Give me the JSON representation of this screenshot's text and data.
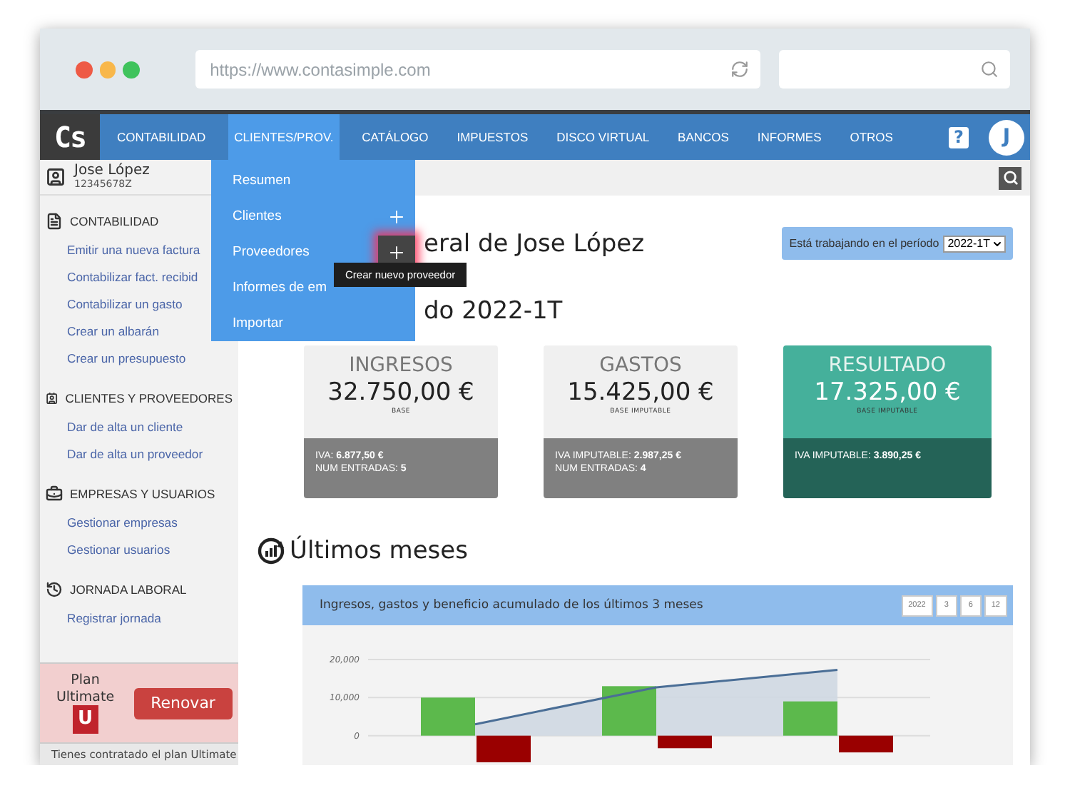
{
  "browser": {
    "url": "https://www.contasimple.com"
  },
  "logo": "Cs",
  "nav": {
    "items": [
      {
        "label": "CONTABILIDAD",
        "selected": false
      },
      {
        "label": "CLIENTES/PROV.",
        "selected": true
      },
      {
        "label": "CATÁLOGO",
        "selected": false
      },
      {
        "label": "IMPUESTOS",
        "selected": false
      },
      {
        "label": "DISCO VIRTUAL",
        "selected": false
      },
      {
        "label": "BANCOS",
        "selected": false
      },
      {
        "label": "INFORMES",
        "selected": false
      },
      {
        "label": "OTROS",
        "selected": false
      }
    ],
    "help": "?",
    "avatar": "J"
  },
  "dropdown": {
    "items": [
      {
        "label": "Resumen"
      },
      {
        "label": "Clientes",
        "add": {
          "hovered": false
        }
      },
      {
        "label": "Proveedores",
        "add": {
          "hovered": true
        },
        "tooltip": "Crear nuevo proveedor"
      },
      {
        "label": "Informes de em"
      },
      {
        "label": "Importar"
      }
    ]
  },
  "user": {
    "name": "Jose López",
    "id": "12345678Z"
  },
  "sidebar": {
    "sections": [
      {
        "kind": "document",
        "title": "CONTABILIDAD",
        "items": [
          "Emitir una nueva factura",
          "Contabilizar fact. recibid",
          "Contabilizar un gasto",
          "Crear un albarán",
          "Crear un presupuesto"
        ]
      },
      {
        "kind": "contact",
        "title": "CLIENTES Y PROVEEDORES",
        "items": [
          "Dar de alta un cliente",
          "Dar de alta un proveedor"
        ]
      },
      {
        "kind": "briefcase",
        "title": "EMPRESAS Y USUARIOS",
        "items": [
          "Gestionar empresas",
          "Gestionar usuarios"
        ]
      },
      {
        "kind": "history",
        "title": "JORNADA LABORAL",
        "items": [
          "Registrar jornada"
        ]
      }
    ]
  },
  "plan": {
    "label": "Plan",
    "name": "Ultimate",
    "badge": "U",
    "button": "Renovar",
    "note": "Tienes contratado el plan Ultimate"
  },
  "main": {
    "title": "eral de Jose López",
    "period": {
      "label": "Está trabajando en el período",
      "value": "2022-1T"
    },
    "subtitle": "do 2022-1T",
    "cards": [
      {
        "kind": "neutral",
        "title": "INGRESOS",
        "amount": "32.750,00 €",
        "base": "BASE",
        "details": [
          {
            "label": "IVA:",
            "value": "6.877,50 €"
          },
          {
            "label": "NUM ENTRADAS:",
            "value": "5"
          }
        ]
      },
      {
        "kind": "neutral",
        "title": "GASTOS",
        "amount": "15.425,00 €",
        "base": "BASE IMPUTABLE",
        "details": [
          {
            "label": "IVA IMPUTABLE:",
            "value": "2.987,25 €"
          },
          {
            "label": "NUM ENTRADAS:",
            "value": "4"
          }
        ]
      },
      {
        "kind": "result",
        "title": "RESULTADO",
        "amount": "17.325,00 €",
        "base": "BASE IMPUTABLE",
        "details": [
          {
            "label": "IVA IMPUTABLE:",
            "value": "3.890,25 €"
          }
        ]
      }
    ],
    "section_title": "Últimos meses",
    "chart": {
      "title": "Ingresos, gastos y beneficio acumulado de los últimos 3 meses",
      "ranges": [
        "2022",
        "3",
        "6",
        "12"
      ],
      "chart_data": {
        "type": "bar",
        "stacked": false,
        "ylim": [
          -7000,
          20000
        ],
        "yticks": [
          {
            "value": 0,
            "label": "0"
          },
          {
            "value": 10000,
            "label": "10,000"
          },
          {
            "value": 20000,
            "label": "20,000"
          }
        ],
        "series": [
          {
            "type": "bar",
            "color": "#5cb94c",
            "values": [
              10000,
              13000,
              9000
            ]
          },
          {
            "type": "bar",
            "color": "#9a0000",
            "values": [
              -7000,
              -3300,
              -4400
            ]
          },
          {
            "type": "area",
            "color": "#4a6e96",
            "values": [
              3000,
              12700,
              17300
            ]
          }
        ]
      }
    }
  }
}
